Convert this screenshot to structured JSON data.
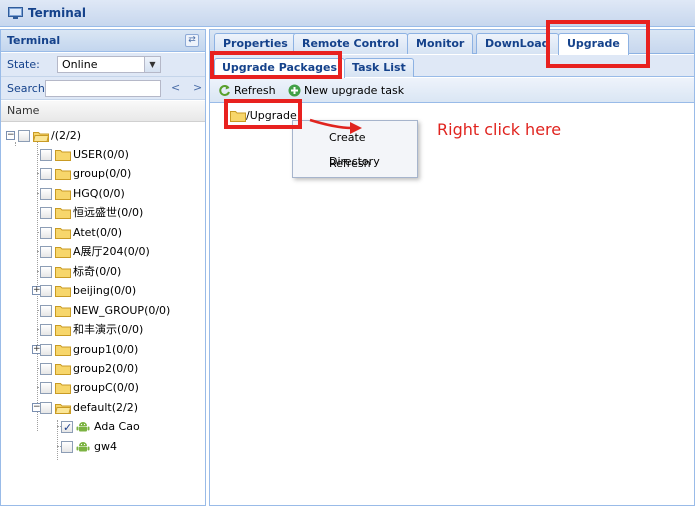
{
  "window": {
    "title": "Terminal"
  },
  "left_panel": {
    "title": "Terminal",
    "state_label": "State:",
    "state_value": "Online",
    "search_label": "Search:",
    "search_value": "",
    "prev_label": "<",
    "next_label": ">",
    "column_header": "Name",
    "tree": {
      "root": "/(2/2)",
      "groups": [
        "USER(0/0)",
        "group(0/0)",
        "HGQ(0/0)",
        "恒远盛世(0/0)",
        "Atet(0/0)",
        "A展厅204(0/0)",
        "标奇(0/0)",
        "beijing(0/0)",
        "NEW_GROUP(0/0)",
        "和丰演示(0/0)",
        "group1(0/0)",
        "group2(0/0)",
        "groupC(0/0)",
        "default(2/2)"
      ],
      "devices": [
        "Ada Cao",
        "gw4"
      ]
    }
  },
  "right_panel": {
    "tabs": [
      "Properties",
      "Remote Control",
      "Monitor",
      "DownLoad",
      "Upgrade"
    ],
    "active_tab": "Upgrade",
    "sub_tabs": [
      "Upgrade Packages",
      "Task List"
    ],
    "active_sub_tab": "Upgrade Packages",
    "actions": {
      "refresh": "Refresh",
      "new_task": "New upgrade task"
    },
    "folder": "/Upgrade",
    "context_menu": [
      "Create Directory",
      "Refresh"
    ]
  },
  "annotation": {
    "text": "Right click here",
    "color": "#e0241f"
  },
  "colors": {
    "accent": "#15428b",
    "highlight": "#e8211f",
    "panel_border": "#99bbe8"
  }
}
